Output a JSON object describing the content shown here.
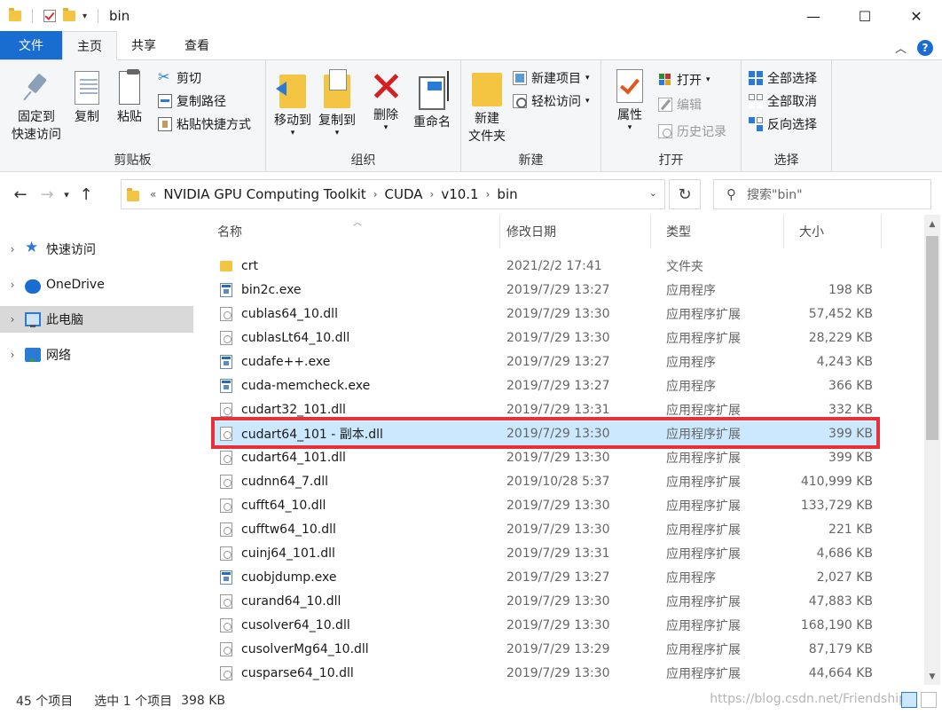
{
  "window": {
    "title": "bin",
    "minimize": "—",
    "maximize": "☐",
    "close": "✕"
  },
  "ribbon_tabs": [
    "文件",
    "主页",
    "共享",
    "查看"
  ],
  "ribbon": {
    "clipboard": {
      "label": "剪贴板",
      "pin_l1": "固定到",
      "pin_l2": "快速访问",
      "copy": "复制",
      "paste": "粘贴",
      "cut": "剪切",
      "copy_path": "复制路径",
      "paste_shortcut": "粘贴快捷方式"
    },
    "organize": {
      "label": "组织",
      "move_to": "移动到",
      "copy_to": "复制到",
      "delete": "删除",
      "rename": "重命名"
    },
    "new": {
      "label": "新建",
      "new_folder_l1": "新建",
      "new_folder_l2": "文件夹",
      "new_item": "新建项目",
      "easy_access": "轻松访问"
    },
    "open": {
      "label": "打开",
      "properties": "属性",
      "open": "打开",
      "edit": "编辑",
      "history": "历史记录"
    },
    "select": {
      "label": "选择",
      "select_all": "全部选择",
      "select_none": "全部取消",
      "invert": "反向选择"
    }
  },
  "address": {
    "overflow": "«",
    "crumbs": [
      "NVIDIA GPU Computing Toolkit",
      "CUDA",
      "v10.1",
      "bin"
    ],
    "search_placeholder": "搜索\"bin\""
  },
  "nav_pane": [
    "快速访问",
    "OneDrive",
    "此电脑",
    "网络"
  ],
  "columns": [
    "名称",
    "修改日期",
    "类型",
    "大小"
  ],
  "files": [
    {
      "name": "crt",
      "date": "2021/2/2 17:41",
      "type": "文件夹",
      "size": "",
      "icon": "folder"
    },
    {
      "name": "bin2c.exe",
      "date": "2019/7/29 13:27",
      "type": "应用程序",
      "size": "198 KB",
      "icon": "exe"
    },
    {
      "name": "cublas64_10.dll",
      "date": "2019/7/29 13:30",
      "type": "应用程序扩展",
      "size": "57,452 KB",
      "icon": "dll"
    },
    {
      "name": "cublasLt64_10.dll",
      "date": "2019/7/29 13:30",
      "type": "应用程序扩展",
      "size": "28,229 KB",
      "icon": "dll"
    },
    {
      "name": "cudafe++.exe",
      "date": "2019/7/29 13:27",
      "type": "应用程序",
      "size": "4,243 KB",
      "icon": "exe"
    },
    {
      "name": "cuda-memcheck.exe",
      "date": "2019/7/29 13:27",
      "type": "应用程序",
      "size": "366 KB",
      "icon": "exe"
    },
    {
      "name": "cudart32_101.dll",
      "date": "2019/7/29 13:31",
      "type": "应用程序扩展",
      "size": "332 KB",
      "icon": "dll"
    },
    {
      "name": "cudart64_101 - 副本.dll",
      "date": "2019/7/29 13:30",
      "type": "应用程序扩展",
      "size": "399 KB",
      "icon": "dll",
      "selected": true
    },
    {
      "name": "cudart64_101.dll",
      "date": "2019/7/29 13:30",
      "type": "应用程序扩展",
      "size": "399 KB",
      "icon": "dll"
    },
    {
      "name": "cudnn64_7.dll",
      "date": "2019/10/28 5:37",
      "type": "应用程序扩展",
      "size": "410,999 KB",
      "icon": "dll"
    },
    {
      "name": "cufft64_10.dll",
      "date": "2019/7/29 13:30",
      "type": "应用程序扩展",
      "size": "133,729 KB",
      "icon": "dll"
    },
    {
      "name": "cufftw64_10.dll",
      "date": "2019/7/29 13:30",
      "type": "应用程序扩展",
      "size": "221 KB",
      "icon": "dll"
    },
    {
      "name": "cuinj64_101.dll",
      "date": "2019/7/29 13:31",
      "type": "应用程序扩展",
      "size": "4,686 KB",
      "icon": "dll"
    },
    {
      "name": "cuobjdump.exe",
      "date": "2019/7/29 13:27",
      "type": "应用程序",
      "size": "2,027 KB",
      "icon": "exe"
    },
    {
      "name": "curand64_10.dll",
      "date": "2019/7/29 13:30",
      "type": "应用程序扩展",
      "size": "47,883 KB",
      "icon": "dll"
    },
    {
      "name": "cusolver64_10.dll",
      "date": "2019/7/29 13:30",
      "type": "应用程序扩展",
      "size": "168,190 KB",
      "icon": "dll"
    },
    {
      "name": "cusolverMg64_10.dll",
      "date": "2019/7/29 13:29",
      "type": "应用程序扩展",
      "size": "87,179 KB",
      "icon": "dll"
    },
    {
      "name": "cusparse64_10.dll",
      "date": "2019/7/29 13:30",
      "type": "应用程序扩展",
      "size": "44,664 KB",
      "icon": "dll"
    }
  ],
  "status": {
    "count": "45 个项目",
    "selected": "选中 1 个项目",
    "size": "398 KB",
    "watermark": "https://blog.csdn.net/Friendship"
  },
  "colors": {
    "file_tab": "#1a6dd0",
    "selection": "#cce8ff",
    "highlight_border": "#e8303a"
  }
}
